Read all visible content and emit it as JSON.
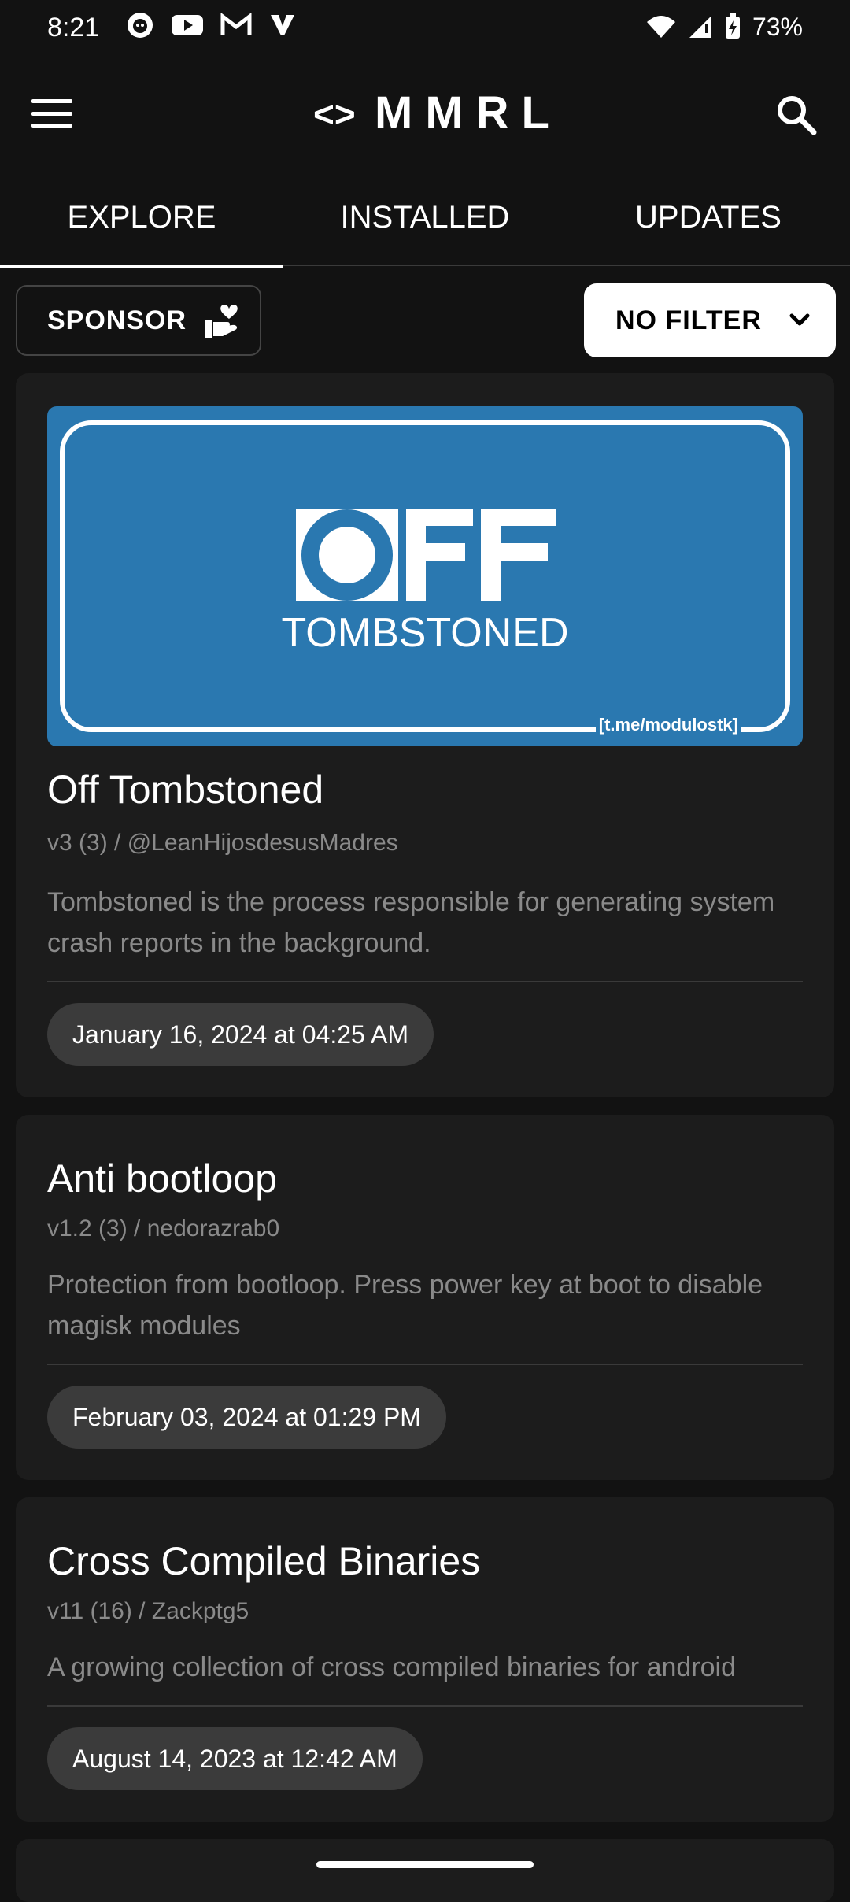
{
  "status_bar": {
    "time": "8:21",
    "left_icons": [
      "github-icon",
      "youtube-icon",
      "gmail-icon",
      "v-app-icon"
    ],
    "battery": "73%"
  },
  "app_bar": {
    "title": "MMRL",
    "logo_glyph": "<>"
  },
  "tabs": [
    {
      "label": "EXPLORE",
      "active": true
    },
    {
      "label": "INSTALLED",
      "active": false
    },
    {
      "label": "UPDATES",
      "active": false
    }
  ],
  "toolbar": {
    "sponsor_label": "SPONSOR",
    "filter_label": "NO FILTER"
  },
  "modules": [
    {
      "banner": {
        "logo_text": "OFF",
        "subtitle": "TOMBSTONED",
        "url": "[t.me/modulostk]"
      },
      "title": "Off Tombstoned",
      "meta": "v3 (3) / @LeanHijosdesusMadres",
      "description": "Tombstoned is the process responsible for generating system crash reports in the background.",
      "date": "January 16, 2024 at 04:25 AM"
    },
    {
      "title": "Anti bootloop",
      "meta": "v1.2 (3) / nedorazrab0",
      "description": "Protection from bootloop. Press power key at boot to disable magisk modules",
      "date": "February 03, 2024 at 01:29 PM"
    },
    {
      "title": "Cross Compiled Binaries",
      "meta": "v11 (16) / Zackptg5",
      "description": "A growing collection of cross compiled binaries for android",
      "date": "August 14, 2023 at 12:42 AM"
    }
  ],
  "colors": {
    "background": "#121212",
    "card": "#1c1c1c",
    "banner_blue": "#2a78b0",
    "chip": "#3b3b3b",
    "muted_text": "#8a8a8a"
  }
}
